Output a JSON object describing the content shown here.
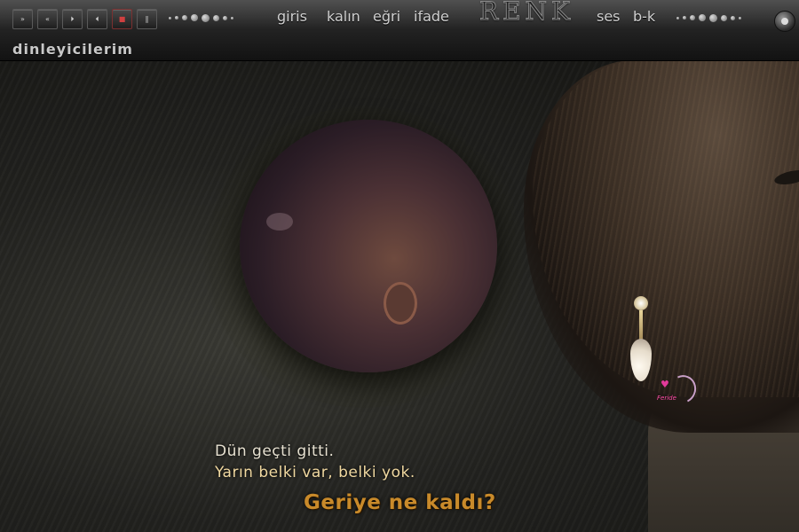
{
  "toolbar": {
    "playback_buttons": [
      {
        "name": "fast-forward",
        "glyph": "»"
      },
      {
        "name": "rewind",
        "glyph": "«"
      },
      {
        "name": "next",
        "glyph": "⏵"
      },
      {
        "name": "previous",
        "glyph": "⏴"
      },
      {
        "name": "stop",
        "glyph": "■"
      },
      {
        "name": "pause",
        "glyph": "∥"
      }
    ],
    "menu": {
      "giris": "giris",
      "kalin": "kalın",
      "egri": "eğri",
      "ifade": "ifade",
      "ses": "ses",
      "bk": "b-k"
    },
    "renk_label": "RENK",
    "section_title": "dinleyicilerim",
    "knob_icon": "volume-knob-icon"
  },
  "poem": {
    "line1": "Dün geçti gitti.",
    "line2": "Yarın belki var, belki yok.",
    "line3": "Geriye ne kaldı?"
  },
  "signature": {
    "label": "Feride"
  },
  "colors": {
    "poem_line1": "#e6e0d0",
    "poem_line2": "#f0d8a0",
    "poem_line3": "#c98a2a",
    "toolbar": "#242424"
  }
}
